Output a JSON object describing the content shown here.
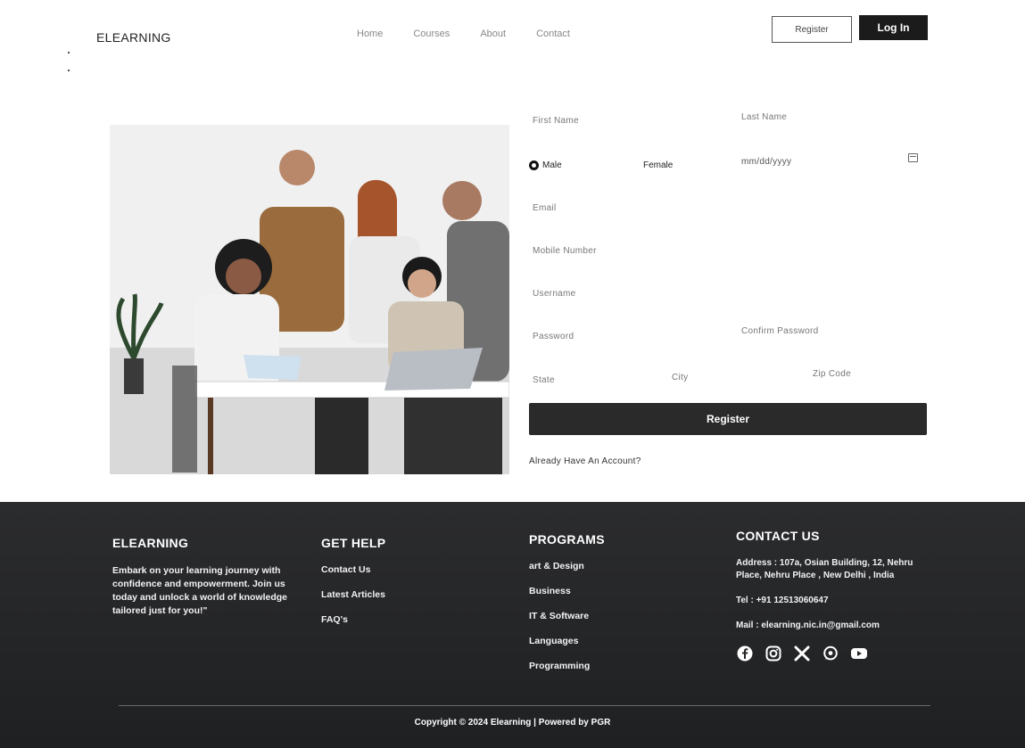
{
  "header": {
    "brand": "ELEARNING",
    "nav": [
      "Home",
      "Courses",
      "About",
      "Contact"
    ],
    "register_label": "Register",
    "login_label": "Log In"
  },
  "form": {
    "first_name": "First Name",
    "last_name": "Last Name",
    "gender_male": "Male",
    "gender_female": "Female",
    "dob_placeholder": "mm/dd/yyyy",
    "email": "Email",
    "mobile": "Mobile Number",
    "username": "Username",
    "password": "Password",
    "confirm_password": "Confirm Password",
    "state": "State",
    "city": "City",
    "zip": "Zip Code",
    "submit_label": "Register",
    "already": "Already Have An Account?"
  },
  "footer": {
    "brand": "ELEARNING",
    "tagline": "Embark on your learning journey with confidence and empowerment. Join us today and unlock a world of knowledge tailored just for you!\"",
    "help_title": "GET HELP",
    "help_links": [
      "Contact Us",
      "Latest Articles",
      "FAQ's"
    ],
    "programs_title": "PROGRAMS",
    "programs": [
      "art & Design",
      "Business",
      "IT & Software",
      "Languages",
      "Programming"
    ],
    "contact_title": "CONTACT US",
    "address": "Address : 107a, Osian Building, 12, Nehru Place, Nehru Place , New Delhi , India",
    "tel": "Tel : +91 12513060647",
    "mail": "Mail : elearning.nic.in@gmail.com",
    "socials": [
      "facebook-icon",
      "instagram-icon",
      "x-icon",
      "whatsapp-icon",
      "youtube-icon"
    ],
    "copyright": "Copyright © 2024 Elearning | Powered by PGR"
  },
  "colors": {
    "dark": "#1b1b1b",
    "footer_bg": "#252628",
    "accent_text": "#ffffff"
  }
}
